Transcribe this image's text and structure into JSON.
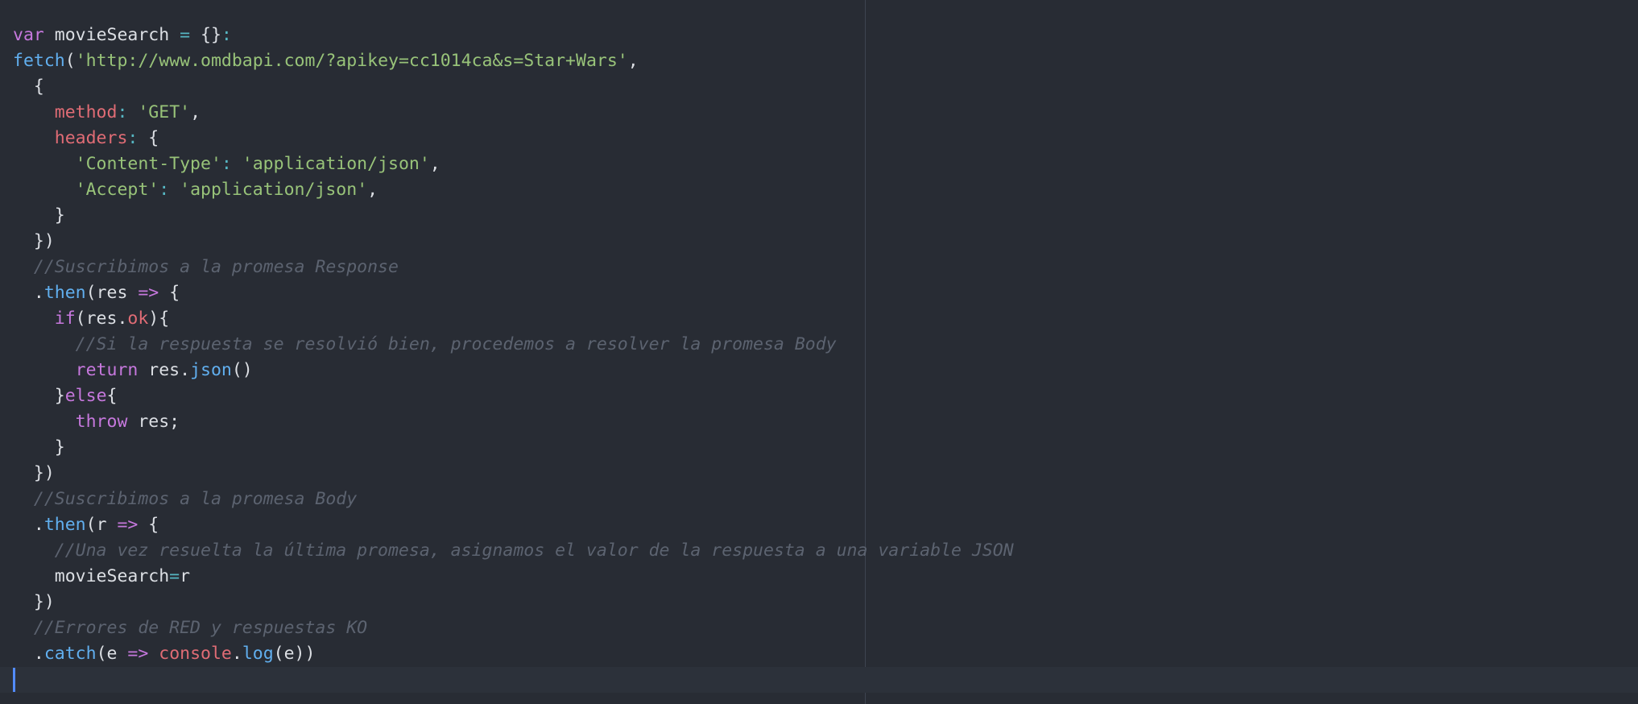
{
  "colors": {
    "background": "#282c34",
    "current_line": "#2c313a",
    "wrap_guide": "#3e4451",
    "cursor": "#528bff",
    "keyword": "#c678dd",
    "function": "#61afef",
    "string": "#98c379",
    "property": "#e06c75",
    "operator": "#56b6c2",
    "comment": "#5c6370",
    "plain": "#dcdfe4"
  },
  "code": {
    "lines": [
      {
        "tokens": [
          {
            "t": "keyword",
            "v": "var"
          },
          {
            "t": "plain",
            "v": " movieSearch "
          },
          {
            "t": "operator",
            "v": "="
          },
          {
            "t": "plain",
            "v": " {}"
          },
          {
            "t": "operator",
            "v": ":"
          }
        ]
      },
      {
        "tokens": [
          {
            "t": "function",
            "v": "fetch"
          },
          {
            "t": "plain",
            "v": "("
          },
          {
            "t": "string",
            "v": "'http://www.omdbapi.com/?apikey=cc1014ca&s=Star+Wars'"
          },
          {
            "t": "plain",
            "v": ","
          }
        ]
      },
      {
        "tokens": [
          {
            "t": "plain",
            "v": "  {"
          }
        ]
      },
      {
        "tokens": [
          {
            "t": "plain",
            "v": "    "
          },
          {
            "t": "property",
            "v": "method"
          },
          {
            "t": "operator",
            "v": ":"
          },
          {
            "t": "plain",
            "v": " "
          },
          {
            "t": "string",
            "v": "'GET'"
          },
          {
            "t": "plain",
            "v": ","
          }
        ]
      },
      {
        "tokens": [
          {
            "t": "plain",
            "v": "    "
          },
          {
            "t": "property",
            "v": "headers"
          },
          {
            "t": "operator",
            "v": ":"
          },
          {
            "t": "plain",
            "v": " {"
          }
        ]
      },
      {
        "tokens": [
          {
            "t": "plain",
            "v": "      "
          },
          {
            "t": "string",
            "v": "'Content-Type'"
          },
          {
            "t": "operator",
            "v": ":"
          },
          {
            "t": "plain",
            "v": " "
          },
          {
            "t": "string",
            "v": "'application/json'"
          },
          {
            "t": "plain",
            "v": ","
          }
        ]
      },
      {
        "tokens": [
          {
            "t": "plain",
            "v": "      "
          },
          {
            "t": "string",
            "v": "'Accept'"
          },
          {
            "t": "operator",
            "v": ":"
          },
          {
            "t": "plain",
            "v": " "
          },
          {
            "t": "string",
            "v": "'application/json'"
          },
          {
            "t": "plain",
            "v": ","
          }
        ]
      },
      {
        "tokens": [
          {
            "t": "plain",
            "v": "    }"
          }
        ]
      },
      {
        "tokens": [
          {
            "t": "plain",
            "v": "  })"
          }
        ]
      },
      {
        "tokens": [
          {
            "t": "plain",
            "v": "  "
          },
          {
            "t": "comment",
            "v": "//Suscribimos a la promesa Response"
          }
        ]
      },
      {
        "tokens": [
          {
            "t": "plain",
            "v": "  ."
          },
          {
            "t": "function",
            "v": "then"
          },
          {
            "t": "plain",
            "v": "(res "
          },
          {
            "t": "keyword",
            "v": "=>"
          },
          {
            "t": "plain",
            "v": " {"
          }
        ]
      },
      {
        "tokens": [
          {
            "t": "plain",
            "v": "    "
          },
          {
            "t": "keyword",
            "v": "if"
          },
          {
            "t": "plain",
            "v": "(res."
          },
          {
            "t": "property",
            "v": "ok"
          },
          {
            "t": "plain",
            "v": "){"
          }
        ]
      },
      {
        "tokens": [
          {
            "t": "plain",
            "v": "      "
          },
          {
            "t": "comment",
            "v": "//Si la respuesta se resolvió bien, procedemos a resolver la promesa Body"
          }
        ]
      },
      {
        "tokens": [
          {
            "t": "plain",
            "v": "      "
          },
          {
            "t": "keyword",
            "v": "return"
          },
          {
            "t": "plain",
            "v": " res."
          },
          {
            "t": "function",
            "v": "json"
          },
          {
            "t": "plain",
            "v": "()"
          }
        ]
      },
      {
        "tokens": [
          {
            "t": "plain",
            "v": "    }"
          },
          {
            "t": "keyword",
            "v": "else"
          },
          {
            "t": "plain",
            "v": "{"
          }
        ]
      },
      {
        "tokens": [
          {
            "t": "plain",
            "v": "      "
          },
          {
            "t": "keyword",
            "v": "throw"
          },
          {
            "t": "plain",
            "v": " res;"
          }
        ]
      },
      {
        "tokens": [
          {
            "t": "plain",
            "v": "    }"
          }
        ]
      },
      {
        "tokens": [
          {
            "t": "plain",
            "v": "  })"
          }
        ]
      },
      {
        "tokens": [
          {
            "t": "plain",
            "v": "  "
          },
          {
            "t": "comment",
            "v": "//Suscribimos a la promesa Body"
          }
        ]
      },
      {
        "tokens": [
          {
            "t": "plain",
            "v": "  ."
          },
          {
            "t": "function",
            "v": "then"
          },
          {
            "t": "plain",
            "v": "(r "
          },
          {
            "t": "keyword",
            "v": "=>"
          },
          {
            "t": "plain",
            "v": " {"
          }
        ]
      },
      {
        "tokens": [
          {
            "t": "plain",
            "v": "    "
          },
          {
            "t": "comment",
            "v": "//Una vez resuelta la última promesa, asignamos el valor de la respuesta a una variable JSON"
          }
        ]
      },
      {
        "tokens": [
          {
            "t": "plain",
            "v": "    movieSearch"
          },
          {
            "t": "operator",
            "v": "="
          },
          {
            "t": "plain",
            "v": "r"
          }
        ]
      },
      {
        "tokens": [
          {
            "t": "plain",
            "v": "  })"
          }
        ]
      },
      {
        "tokens": [
          {
            "t": "plain",
            "v": "  "
          },
          {
            "t": "comment",
            "v": "//Errores de RED y respuestas KO"
          }
        ]
      },
      {
        "tokens": [
          {
            "t": "plain",
            "v": "  ."
          },
          {
            "t": "function",
            "v": "catch"
          },
          {
            "t": "plain",
            "v": "(e "
          },
          {
            "t": "keyword",
            "v": "=>"
          },
          {
            "t": "plain",
            "v": " "
          },
          {
            "t": "property",
            "v": "console"
          },
          {
            "t": "plain",
            "v": "."
          },
          {
            "t": "function",
            "v": "log"
          },
          {
            "t": "plain",
            "v": "(e))"
          }
        ]
      }
    ]
  }
}
